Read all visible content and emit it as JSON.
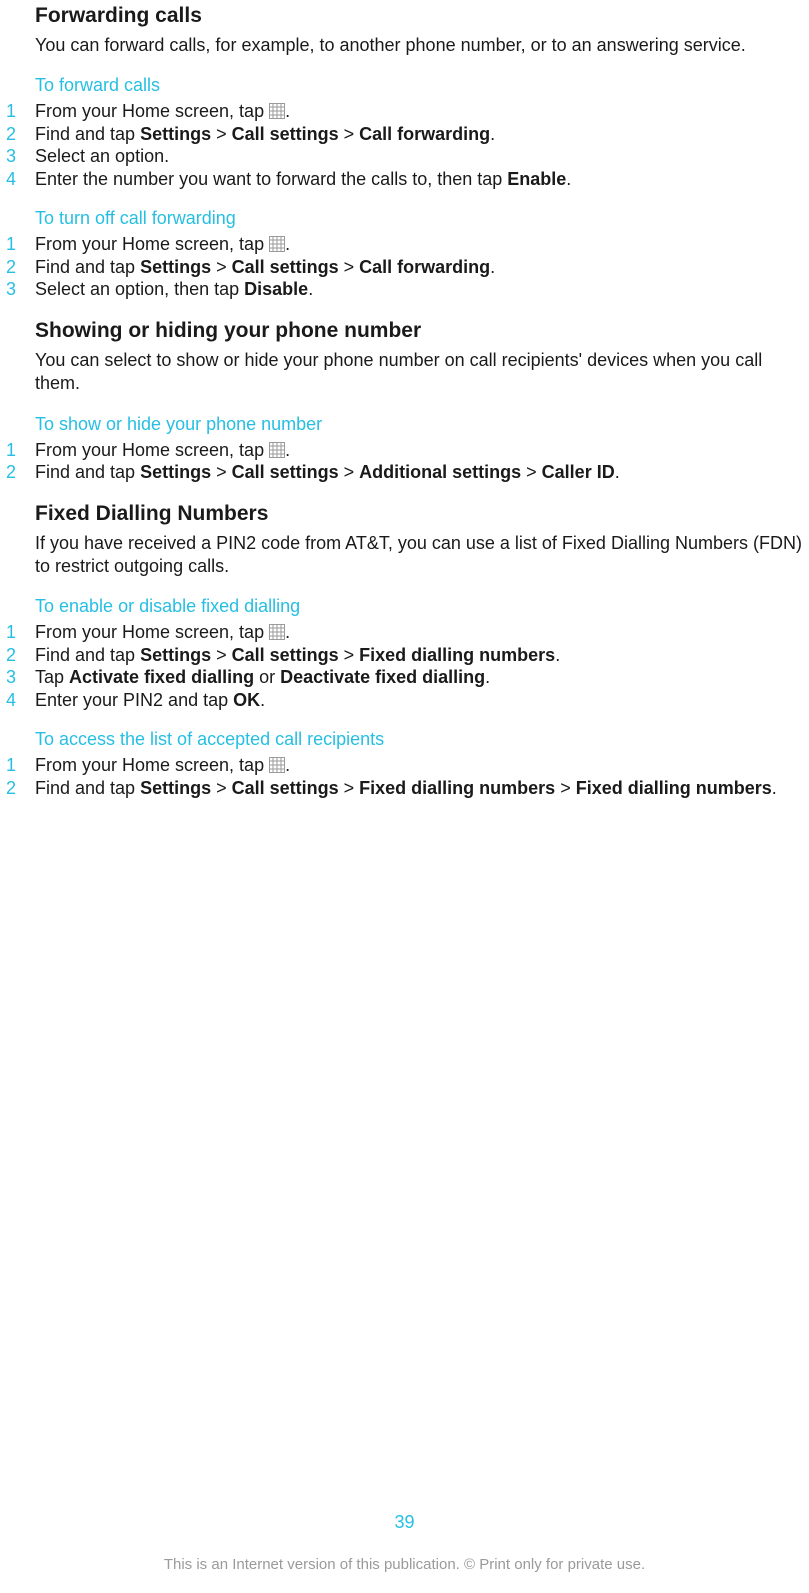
{
  "sections": {
    "forwarding": {
      "title": "Forwarding calls",
      "intro": "You can forward calls, for example, to another phone number, or to an answering service."
    },
    "showhide": {
      "title": "Showing or hiding your phone number",
      "intro": "You can select to show or hide your phone number on call recipients' devices when you call them."
    },
    "fdn": {
      "title": "Fixed Dialling Numbers",
      "intro": "If you have received a PIN2 code from AT&T, you can use a list of Fixed Dialling Numbers (FDN) to restrict outgoing calls."
    }
  },
  "sub": {
    "forward_calls": "To forward calls",
    "turn_off": "To turn off call forwarding",
    "show_hide": "To show or hide your phone number",
    "enable_fdn": "To enable or disable fixed dialling",
    "access_fdn": "To access the list of accepted call recipients"
  },
  "common": {
    "home_prefix": "From your Home screen, tap ",
    "find_tap": "Find and tap ",
    "tap": "Tap ",
    "period": ".",
    "gt": " > "
  },
  "bold": {
    "settings": "Settings",
    "call_settings": "Call settings",
    "call_forwarding": "Call forwarding",
    "additional_settings": "Additional settings",
    "caller_id": "Caller ID",
    "fixed_dialling_numbers": "Fixed dialling numbers",
    "enable": "Enable",
    "disable": "Disable",
    "activate_fd": "Activate fixed dialling",
    "deactivate_fd": "Deactivate fixed dialling",
    "ok": "OK"
  },
  "steps": {
    "fwd1_3": "Select an option.",
    "fwd1_4a": "Enter the number you want to forward the calls to, then tap ",
    "fwd2_3a": "Select an option, then tap ",
    "fdn1_4a": "Enter your PIN2 and tap ",
    "or": " or "
  },
  "nums": {
    "n1": "1",
    "n2": "2",
    "n3": "3",
    "n4": "4"
  },
  "page_number": "39",
  "footer": "This is an Internet version of this publication. © Print only for private use."
}
